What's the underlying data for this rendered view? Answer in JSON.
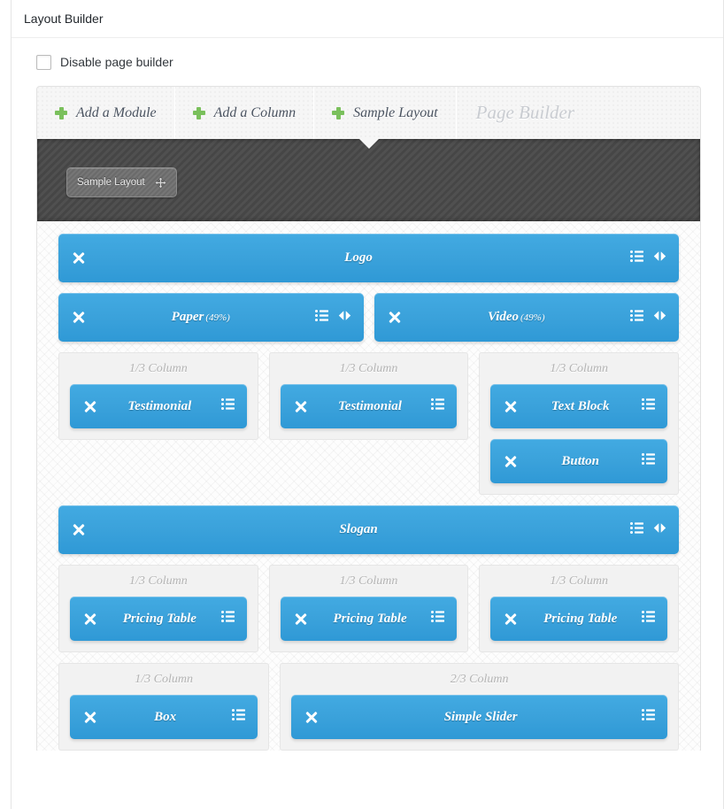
{
  "metabox": {
    "title": "Layout Builder"
  },
  "options": {
    "disable_label": "Disable page builder"
  },
  "tabs": [
    {
      "label": "Add a Module",
      "icon": "plus-icon"
    },
    {
      "label": "Add a Column",
      "icon": "plus-icon"
    },
    {
      "label": "Sample Layout",
      "icon": "plus-icon"
    }
  ],
  "builder_title": "Page Builder",
  "row": {
    "drag_tag_label": "Sample Layout",
    "drag_icon": "move-icon"
  },
  "icons": {
    "close": "close-icon",
    "settings": "settings-list-icon",
    "resize": "resize-horizontal-icon"
  },
  "colors": {
    "module_blue": "#3aa4dd",
    "plus_green": "#7ac05c",
    "row_dark": "#4a4a4a",
    "column_gray": "#f2f2f2"
  },
  "canvas": {
    "rows": [
      {
        "type": "modules",
        "modules": [
          {
            "title": "Logo",
            "pct": "",
            "has_resize": true
          }
        ]
      },
      {
        "type": "modules",
        "modules": [
          {
            "title": "Paper",
            "pct": "(49%)",
            "has_resize": true
          },
          {
            "title": "Video",
            "pct": "(49%)",
            "has_resize": true
          }
        ]
      },
      {
        "type": "columns",
        "columns": [
          {
            "label": "1/3 Column",
            "width": "1/3",
            "modules": [
              {
                "title": "Testimonial",
                "pct": ""
              }
            ]
          },
          {
            "label": "1/3 Column",
            "width": "1/3",
            "modules": [
              {
                "title": "Testimonial",
                "pct": ""
              }
            ]
          },
          {
            "label": "1/3 Column",
            "width": "1/3",
            "modules": [
              {
                "title": "Text Block",
                "pct": ""
              },
              {
                "title": "Button",
                "pct": ""
              }
            ]
          }
        ]
      },
      {
        "type": "modules",
        "modules": [
          {
            "title": "Slogan",
            "pct": "",
            "has_resize": true
          }
        ]
      },
      {
        "type": "columns",
        "columns": [
          {
            "label": "1/3 Column",
            "width": "1/3",
            "modules": [
              {
                "title": "Pricing Table",
                "pct": ""
              }
            ]
          },
          {
            "label": "1/3 Column",
            "width": "1/3",
            "modules": [
              {
                "title": "Pricing Table",
                "pct": ""
              }
            ]
          },
          {
            "label": "1/3 Column",
            "width": "1/3",
            "modules": [
              {
                "title": "Pricing Table",
                "pct": ""
              }
            ]
          }
        ]
      },
      {
        "type": "columns",
        "columns": [
          {
            "label": "1/3 Column",
            "width": "1/3",
            "modules": [
              {
                "title": "Box",
                "pct": ""
              }
            ]
          },
          {
            "label": "2/3 Column",
            "width": "2/3",
            "modules": [
              {
                "title": "Simple Slider",
                "pct": ""
              }
            ]
          }
        ]
      }
    ]
  }
}
